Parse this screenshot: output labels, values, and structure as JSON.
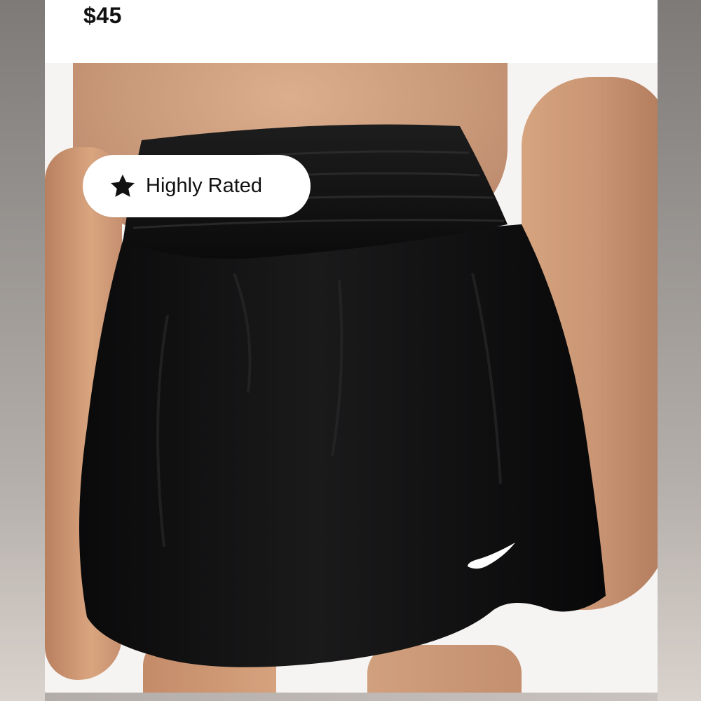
{
  "listing": {
    "price": "$45",
    "badge": {
      "label": "Highly Rated",
      "icon": "star-icon"
    },
    "photo": {
      "logo": "nike-swoosh"
    }
  },
  "colors": {
    "badge_background": "#ffffff",
    "price_text": "#111111",
    "shorts": "#0f0f10",
    "logo": "#ffffff"
  }
}
